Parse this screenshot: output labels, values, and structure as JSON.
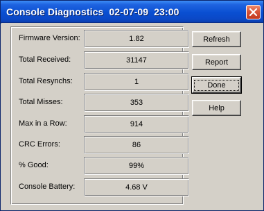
{
  "window": {
    "title": "Console Diagnostics  02-07-09  23:00",
    "close_icon": "close-icon"
  },
  "stats": [
    {
      "label": "Firmware Version:",
      "value": "1.82"
    },
    {
      "label": "Total Received:",
      "value": "31147"
    },
    {
      "label": "Total Resynchs:",
      "value": "1"
    },
    {
      "label": "Total Misses:",
      "value": "353"
    },
    {
      "label": "Max in a Row:",
      "value": "914"
    },
    {
      "label": "CRC Errors:",
      "value": "86"
    },
    {
      "label": "% Good:",
      "value": "99%"
    },
    {
      "label": "Console Battery:",
      "value": "4.68 V"
    }
  ],
  "buttons": {
    "refresh": "Refresh",
    "report": "Report",
    "done": "Done",
    "help": "Help"
  },
  "colors": {
    "titlebar": "#0a4fd2",
    "close_button": "#d8553a",
    "face": "#d4d0c8"
  }
}
